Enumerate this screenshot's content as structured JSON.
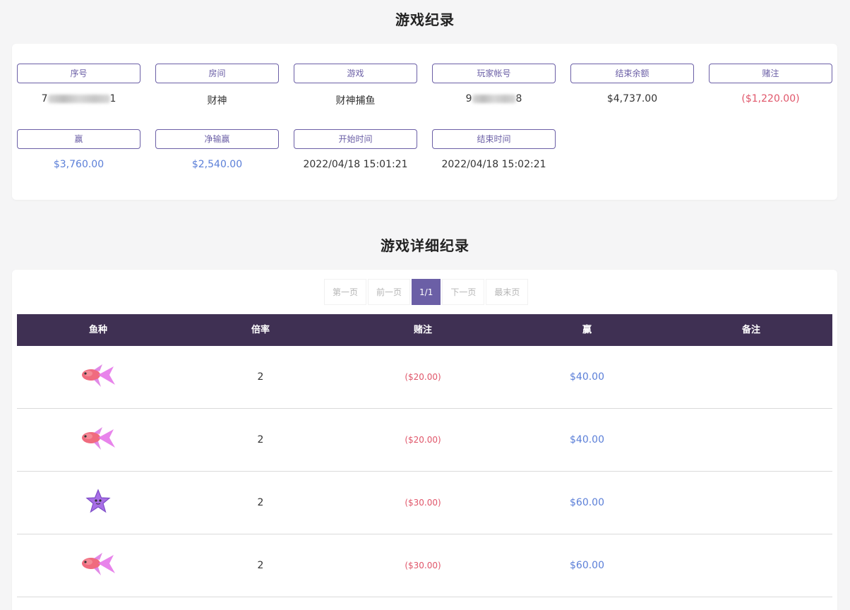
{
  "titles": {
    "record": "游戏纪录",
    "detail": "游戏详细纪录"
  },
  "summary": {
    "serial": {
      "label": "序号",
      "prefix": "7",
      "suffix": "1"
    },
    "room": {
      "label": "房间",
      "value": "财神"
    },
    "game": {
      "label": "游戏",
      "value": "财神捕鱼"
    },
    "player": {
      "label": "玩家帐号",
      "prefix": "9",
      "suffix": "8"
    },
    "balance": {
      "label": "结束余额",
      "value": "$4,737.00"
    },
    "bet": {
      "label": "赌注",
      "value": "($1,220.00)"
    },
    "win": {
      "label": "赢",
      "value": "$3,760.00"
    },
    "net": {
      "label": "净输赢",
      "value": "$2,540.00"
    },
    "start": {
      "label": "开始时间",
      "value": "2022/04/18 15:01:21"
    },
    "end": {
      "label": "结束时间",
      "value": "2022/04/18 15:02:21"
    }
  },
  "pager": {
    "first": "第一页",
    "prev": "前一页",
    "current": "1/1",
    "next": "下一页",
    "last": "最末页"
  },
  "table": {
    "headers": [
      "鱼种",
      "倍率",
      "赌注",
      "赢",
      "备注"
    ],
    "rows": [
      {
        "fish": "pink-fish",
        "multiplier": "2",
        "bet": "($20.00)",
        "win": "$40.00",
        "note": ""
      },
      {
        "fish": "pink-fish",
        "multiplier": "2",
        "bet": "($20.00)",
        "win": "$40.00",
        "note": ""
      },
      {
        "fish": "purple-starfish",
        "multiplier": "2",
        "bet": "($30.00)",
        "win": "$60.00",
        "note": ""
      },
      {
        "fish": "pink-fish",
        "multiplier": "2",
        "bet": "($30.00)",
        "win": "$60.00",
        "note": ""
      }
    ]
  },
  "colors": {
    "accent": "#6b5fa6",
    "header_bg": "#3f3053",
    "negative": "#e0566a",
    "positive": "#5b7fd8"
  }
}
